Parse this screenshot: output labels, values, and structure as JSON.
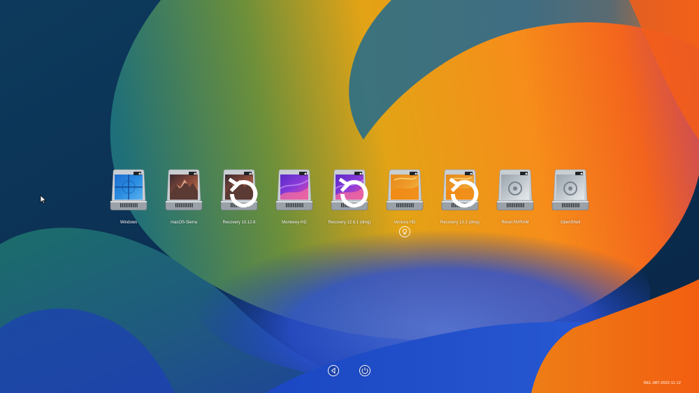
{
  "picker": {
    "entries": [
      {
        "label": "Windows",
        "kind": "windows",
        "recovery": false
      },
      {
        "label": "macOS-Sierra",
        "kind": "sierra",
        "recovery": false
      },
      {
        "label": "Recovery 10.12.6",
        "kind": "sierra",
        "recovery": true
      },
      {
        "label": "Monterey-HD",
        "kind": "monterey",
        "recovery": false
      },
      {
        "label": "Recovery 12.6.1 (dmg)",
        "kind": "monterey",
        "recovery": true
      },
      {
        "label": "Ventura HD",
        "kind": "ventura",
        "recovery": false
      },
      {
        "label": "Recovery 13.1 (dmg)",
        "kind": "ventura",
        "recovery": true
      },
      {
        "label": "Reset NVRAM",
        "kind": "tool",
        "recovery": false
      },
      {
        "label": "OpenShell",
        "kind": "tool",
        "recovery": false
      }
    ],
    "selected_index": 5
  },
  "controls": {
    "restart_icon": "restart-icon",
    "power_icon": "power-icon"
  },
  "version": "REL-087-2022-11-12",
  "colors": {
    "label_text": "#ffffff",
    "wallpaper_dark": "#0b2a4e",
    "wallpaper_orange": "#f58a12",
    "wallpaper_blue": "#1f45c8"
  }
}
